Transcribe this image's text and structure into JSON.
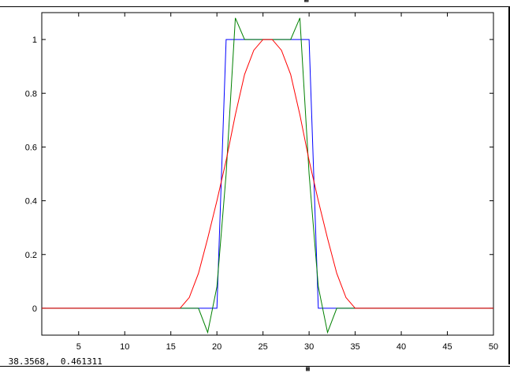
{
  "window": {
    "top_text": "",
    "top_glyph": "▩",
    "status_text": "",
    "status_glyph": "▩"
  },
  "coord_readout": " 38.3568,  0.461311",
  "chart_data": {
    "type": "line",
    "title": "",
    "xlabel": "",
    "ylabel": "",
    "xlim": [
      1,
      50
    ],
    "ylim": [
      -0.1,
      1.1
    ],
    "xticks": [
      5,
      10,
      15,
      20,
      25,
      30,
      35,
      40,
      45,
      50
    ],
    "yticks": [
      0,
      0.2,
      0.4,
      0.6,
      0.8,
      1
    ],
    "ytick_labels": [
      "0",
      "0.2",
      "0.4",
      "0.6",
      "0.8",
      "1"
    ],
    "grid": false,
    "series": [
      {
        "color": "#0000ff",
        "x": [
          1,
          20,
          21,
          30,
          31,
          50
        ],
        "y": [
          0,
          0,
          1,
          1,
          0,
          0
        ]
      },
      {
        "color": "#008000",
        "x": [
          1,
          16,
          17,
          18,
          19,
          20,
          21,
          22,
          23,
          24,
          25,
          26,
          27,
          28,
          29,
          30,
          31,
          32,
          33,
          34,
          35,
          50
        ],
        "y": [
          0,
          0,
          0,
          0,
          -0.09,
          0.08,
          0.5,
          1.08,
          1.0,
          1.0,
          1.0,
          1.0,
          1.0,
          1.0,
          1.08,
          0.5,
          0.08,
          -0.09,
          0,
          0,
          0,
          0
        ]
      },
      {
        "color": "#ff0000",
        "x": [
          1,
          16,
          17,
          18,
          19,
          20,
          21,
          22,
          23,
          24,
          25,
          26,
          27,
          28,
          29,
          30,
          31,
          32,
          33,
          34,
          35,
          50
        ],
        "y": [
          0,
          0,
          0.04,
          0.13,
          0.26,
          0.4,
          0.55,
          0.72,
          0.87,
          0.96,
          1.0,
          1.0,
          0.96,
          0.87,
          0.72,
          0.55,
          0.4,
          0.26,
          0.13,
          0.04,
          0,
          0
        ]
      }
    ]
  }
}
